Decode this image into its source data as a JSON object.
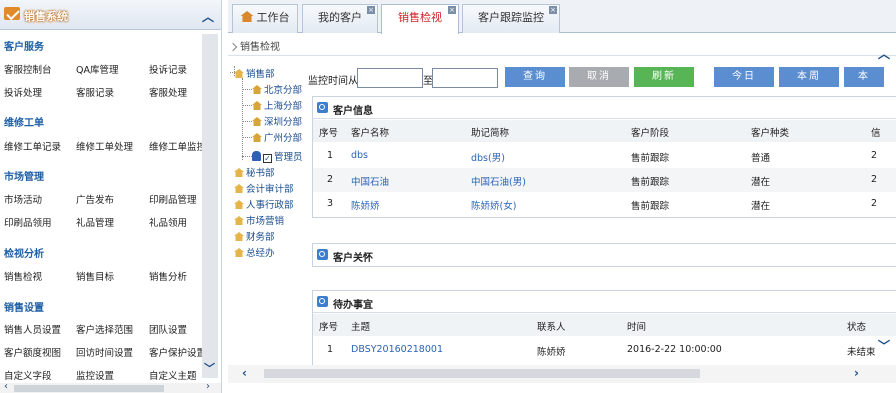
{
  "sidebar": {
    "title": "销售系统",
    "sections": [
      {
        "label": "客户服务",
        "items": [
          "客服控制台",
          "QA库管理",
          "投诉记录",
          "投诉处理",
          "客服记录",
          "客服处理"
        ]
      },
      {
        "label": "维修工单",
        "items": [
          "维修工单记录",
          "维修工单处理",
          "维修工单监控"
        ]
      },
      {
        "label": "市场管理",
        "items": [
          "市场活动",
          "广告发布",
          "印刷品管理",
          "印刷品领用",
          "礼品管理",
          "礼品领用"
        ]
      },
      {
        "label": "检视分析",
        "items": [
          "销售检视",
          "销售目标",
          "销售分析"
        ]
      },
      {
        "label": "销售设置",
        "items": [
          "销售人员设置",
          "客户选择范围",
          "团队设置",
          "客户额度视图",
          "回访时间设置",
          "客户保护设置",
          "自定义字段",
          "监控设置",
          "自定义主题"
        ]
      }
    ]
  },
  "tabs": [
    {
      "label": "工作台",
      "icon": "home-icon",
      "active": false,
      "closable": false
    },
    {
      "label": "我的客户",
      "active": false,
      "closable": true
    },
    {
      "label": "销售检视",
      "active": true,
      "closable": true
    },
    {
      "label": "客户跟踪监控",
      "active": false,
      "closable": true
    }
  ],
  "breadcrumb": "销售检视",
  "org_tree": {
    "root": "销售部",
    "branches": [
      "北京分部",
      "上海分部",
      "深圳分部",
      "广州分部"
    ],
    "admin": "管理员",
    "admin_checked": true,
    "others": [
      "秘书部",
      "会计审计部",
      "人事行政部",
      "市场营销",
      "财务部",
      "总经办"
    ]
  },
  "filter": {
    "label_from": "监控时间从",
    "label_to": "至",
    "from_value": "",
    "to_value": "",
    "buttons": {
      "query": "查询",
      "cancel": "取消",
      "refresh": "刷新",
      "today": "今日",
      "this_week": "本周",
      "this_month": "本"
    }
  },
  "customer_info": {
    "title": "客户信息",
    "headers": [
      "序号",
      "客户名称",
      "助记简称",
      "客户阶段",
      "客户种类",
      "信"
    ],
    "rows": [
      {
        "no": "1",
        "name": "dbs",
        "alias": "dbs(男)",
        "stage": "售前跟踪",
        "type": "普通",
        "extra": "2"
      },
      {
        "no": "2",
        "name": "中国石油",
        "alias": "中国石油(男)",
        "stage": "售前跟踪",
        "type": "潜在",
        "extra": "2"
      },
      {
        "no": "3",
        "name": "陈娇娇",
        "alias": "陈娇娇(女)",
        "stage": "售前跟踪",
        "type": "潜在",
        "extra": "2"
      }
    ]
  },
  "customer_care": {
    "title": "客户关怀"
  },
  "todo": {
    "title": "待办事宜",
    "headers": [
      "序号",
      "主题",
      "联系人",
      "时间",
      "状态"
    ],
    "rows": [
      {
        "no": "1",
        "subject": "DBSY20160218001",
        "contact": "陈娇娇",
        "time": "2016-2-22 10:00:00",
        "status": "未结束"
      }
    ]
  },
  "colors": {
    "accent_red": "#d0242b",
    "link_blue": "#2a63b8",
    "section_blue": "#1f5fa6",
    "btn_blue": "#5b8ed1",
    "btn_gray": "#a8acb0",
    "btn_green": "#58b555"
  }
}
